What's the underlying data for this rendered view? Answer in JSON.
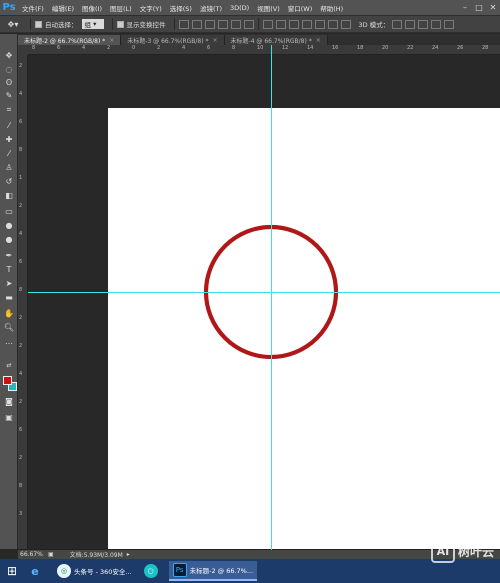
{
  "menu": {
    "logo": "Ps",
    "items": [
      "文件(F)",
      "编辑(E)",
      "图像(I)",
      "图层(L)",
      "文字(Y)",
      "选择(S)",
      "滤镜(T)",
      "3D(D)",
      "视图(V)",
      "窗口(W)",
      "帮助(H)"
    ]
  },
  "options": {
    "auto_select_label": "自动选择：",
    "auto_select_value": "组",
    "show_transform_label": "显示变换控件",
    "mode_label": "3D 模式："
  },
  "tabs": [
    {
      "label": "未标题-2 @ 66.7%(RGB/8) *",
      "active": true
    },
    {
      "label": "未标题-3 @ 66.7%(RGB/8) *",
      "active": false
    },
    {
      "label": "未标题-4 @ 66.7%(RGB/8) *",
      "active": false
    }
  ],
  "rulers": {
    "top": [
      "8",
      "6",
      "4",
      "2",
      "0",
      "2",
      "4",
      "6",
      "8",
      "10",
      "12",
      "14",
      "16",
      "18",
      "20",
      "22",
      "24",
      "26",
      "28"
    ],
    "left": [
      "2",
      "4",
      "6",
      "8",
      "1",
      "2",
      "4",
      "6",
      "8",
      "2",
      "2",
      "4",
      "2",
      "6",
      "2",
      "8",
      "3"
    ]
  },
  "colors": {
    "foreground": "#d01010",
    "background": "#2bb3c0",
    "guide": "#3fe0e8",
    "circle_stroke": "#b01818"
  },
  "status": {
    "zoom": "66.67%",
    "doc": "文档:5.93M/3.09M"
  },
  "taskbar": {
    "items": [
      {
        "label": "头条号 - 360安全...",
        "icon": "browser-360-icon"
      },
      {
        "label": "",
        "icon": "app-circle-icon"
      },
      {
        "label": "未标题-2 @ 66.7%...",
        "icon": "photoshop-icon"
      }
    ]
  },
  "watermark": {
    "badge": "AI",
    "text": "树叶云"
  }
}
